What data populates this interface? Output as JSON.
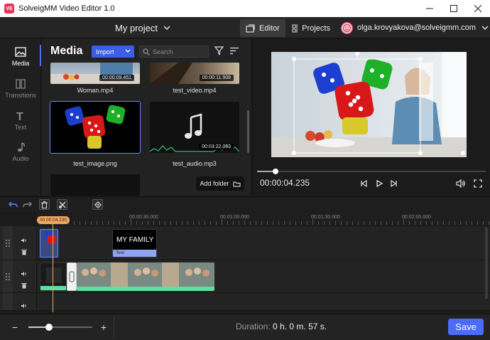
{
  "window": {
    "title": "SolveigMM Video Editor 1.0",
    "icon_text": "VE"
  },
  "header": {
    "project_name": "My project",
    "tabs": [
      {
        "label": "Editor",
        "active": true
      },
      {
        "label": "Projects",
        "active": false
      }
    ],
    "account_email": "olga.krovyakova@solveigmm.com"
  },
  "sidebar": {
    "items": [
      {
        "label": "Media",
        "icon": "image-icon",
        "active": true
      },
      {
        "label": "Transitions",
        "icon": "transitions-icon",
        "active": false
      },
      {
        "label": "Text",
        "icon": "text-icon",
        "active": false
      },
      {
        "label": "Audio",
        "icon": "music-note-icon",
        "active": false
      }
    ]
  },
  "media": {
    "title": "Media",
    "import_label": "Import",
    "search_placeholder": "Search",
    "items": [
      {
        "name": "Woman.mp4",
        "duration": "00:00:09.451"
      },
      {
        "name": "test_video.mp4",
        "duration": "00:00:11.908"
      },
      {
        "name": "test_image.png",
        "duration": ""
      },
      {
        "name": "test_audio.mp3",
        "duration": "00:03:22.083"
      }
    ],
    "add_folder_label": "Add folder"
  },
  "preview": {
    "timecode": "00:00:04.235",
    "progress": 0.08
  },
  "timeline": {
    "playhead_time": "00:00:04.235",
    "ruler_labels": [
      "00:00:30.000",
      "00:01:00.000",
      "00:01:30.000",
      "00:02:00.000"
    ],
    "text_clip": {
      "title": "MY FAMILY",
      "tag": "Text"
    }
  },
  "bottom": {
    "zoom_minus": "−",
    "zoom_plus": "+",
    "zoom_level": 0.32,
    "duration_label": "Duration:",
    "duration_value": "0 h. 0 m. 57 s.",
    "save_label": "Save"
  },
  "colors": {
    "accent": "#4a6cf7",
    "playhead": "#f0a864",
    "audio_band": "#5be0a0"
  }
}
